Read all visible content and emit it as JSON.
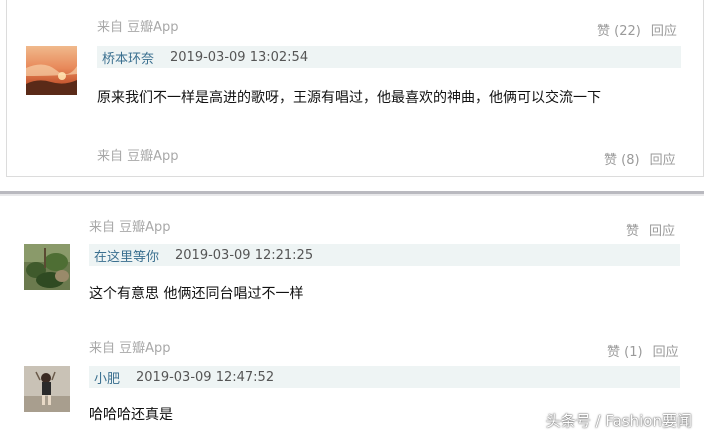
{
  "comments": [
    {
      "source": "来自 豆瓣App",
      "like": "赞 (22)",
      "reply": "回应",
      "author": "桥本环奈",
      "time": "2019-03-09 13:02:54",
      "text": "原来我们不一样是高进的歌呀，王源有唱过，他最喜欢的神曲，他俩可以交流一下",
      "footer_source": "来自 豆瓣App",
      "footer_like": "赞 (8)",
      "footer_reply": "回应"
    },
    {
      "source": "来自 豆瓣App",
      "like": "赞",
      "reply": "回应",
      "author": "在这里等你",
      "time": "2019-03-09 12:21:25",
      "text": "这个有意思 他俩还同台唱过不一样"
    },
    {
      "source": "来自 豆瓣App",
      "like": "赞 (1)",
      "reply": "回应",
      "author": "小肥",
      "time": "2019-03-09 12:47:52",
      "text": "哈哈哈还真是"
    }
  ],
  "watermark": "头条号 / Fashion要闻"
}
